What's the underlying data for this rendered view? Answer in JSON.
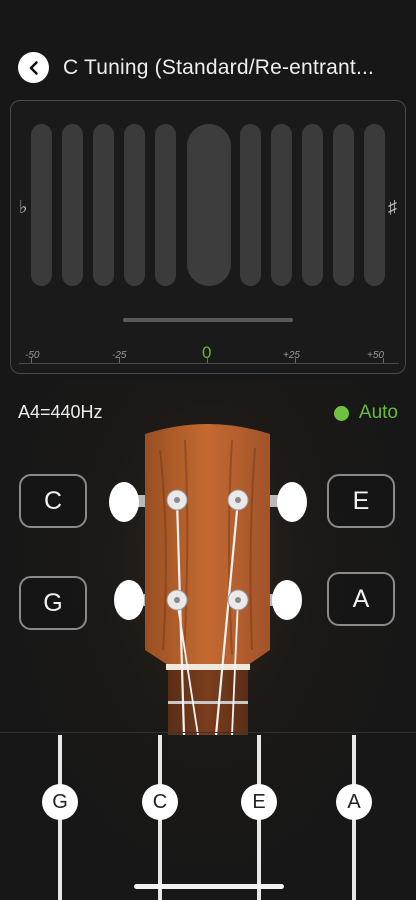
{
  "header": {
    "back_icon": "chevron-left-icon",
    "title": "C Tuning (Standard/Re-entrant..."
  },
  "tuner": {
    "flat_symbol": "♭",
    "sharp_symbol": "♯",
    "scale": {
      "minus50": "-50",
      "minus25": "-25",
      "zero": "0",
      "plus25": "+25",
      "plus50": "+50"
    },
    "accent_color": "#6fc23d"
  },
  "reference": {
    "label": "A4=440Hz"
  },
  "mode": {
    "label": "Auto",
    "color": "#6fc23d"
  },
  "pegs": {
    "top_left": "C",
    "top_right": "E",
    "bottom_left": "G",
    "bottom_right": "A"
  },
  "strings": [
    "G",
    "C",
    "E",
    "A"
  ]
}
